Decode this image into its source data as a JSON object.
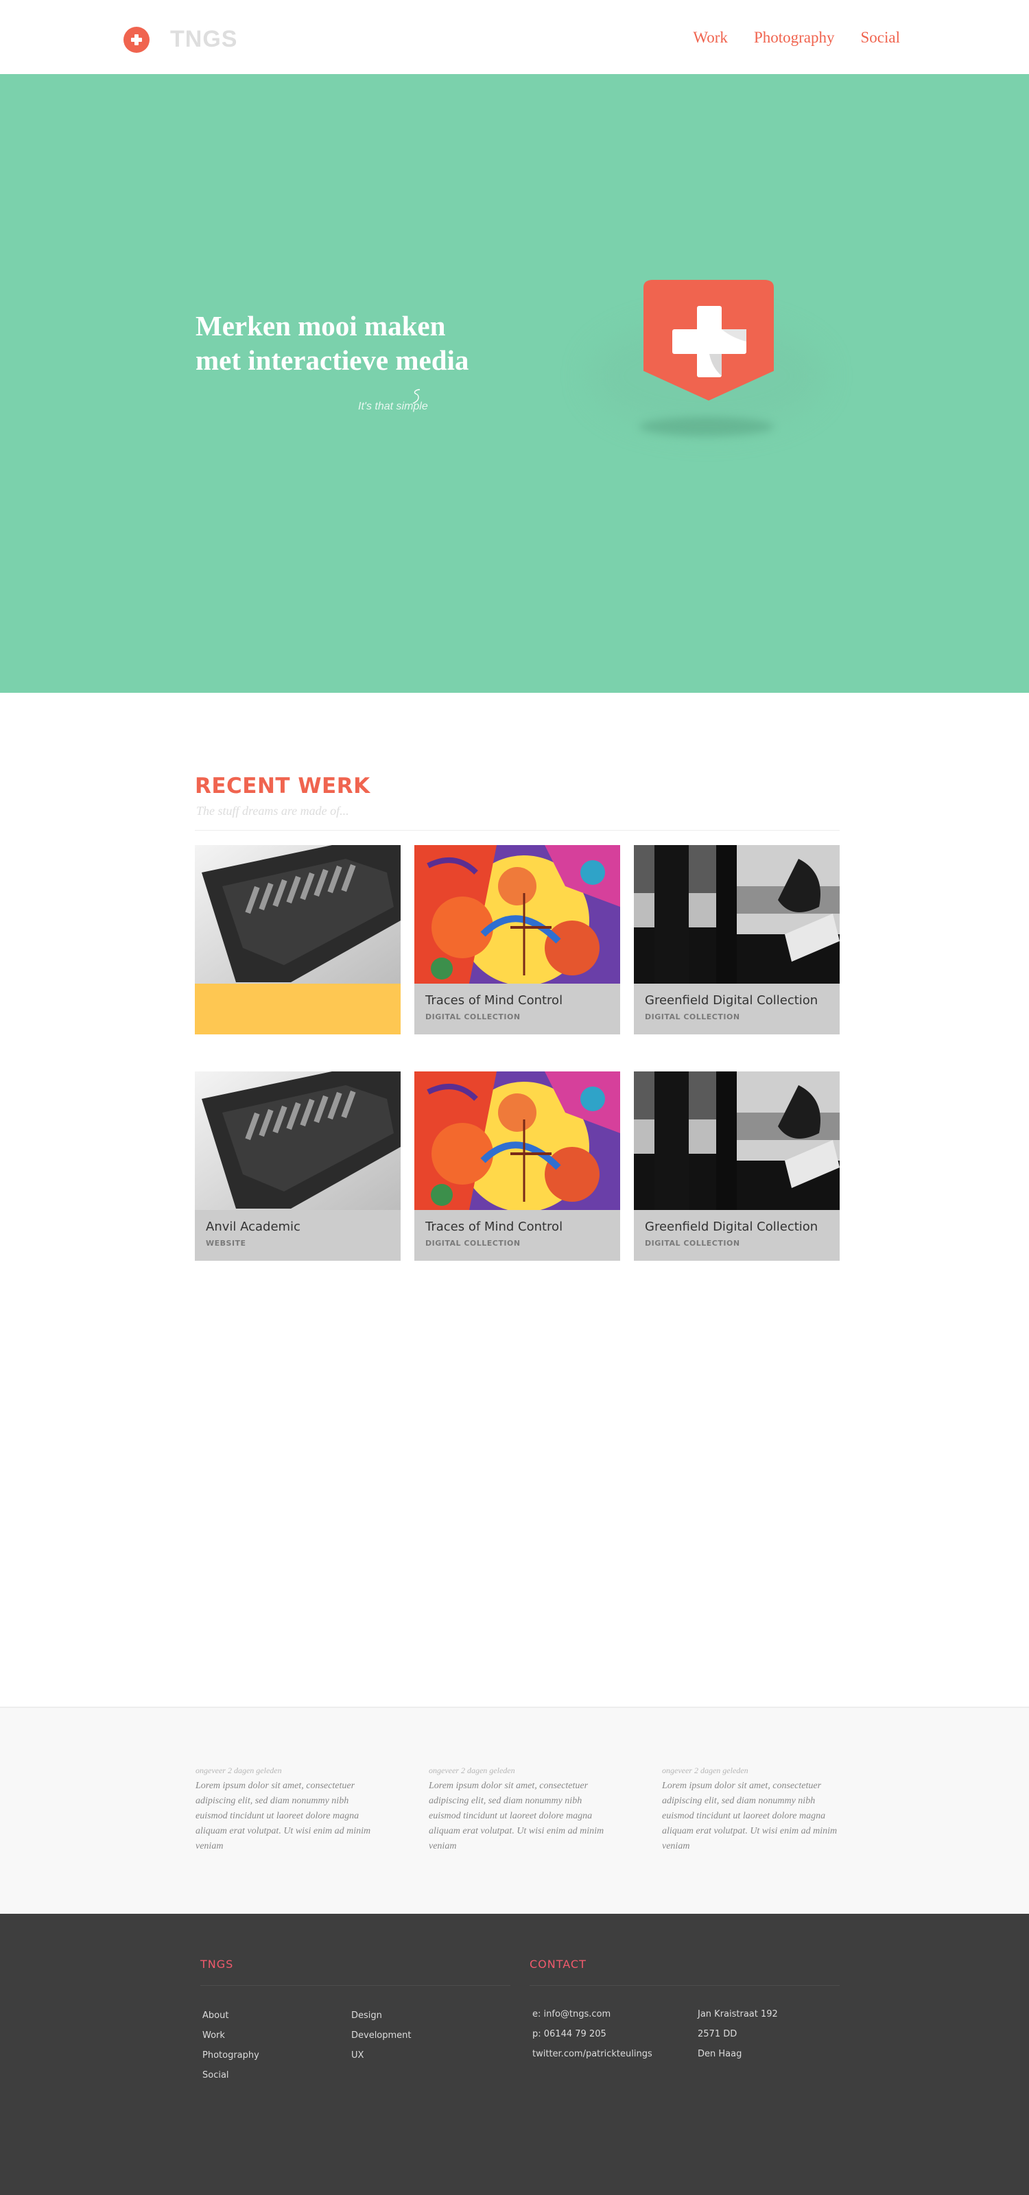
{
  "header": {
    "logo_text": "TNGS",
    "nav": [
      {
        "label": "Work"
      },
      {
        "label": "Photography"
      },
      {
        "label": "Social"
      }
    ]
  },
  "hero": {
    "title_line1": "Merken mooi maken",
    "title_line2": "met interactieve media",
    "subtitle": "It's that simple"
  },
  "recent_work": {
    "title": "RECENT WERK",
    "subtitle": "The stuff dreams are made of...",
    "cards": [
      {
        "title": "",
        "category": "",
        "image": "kindle-photo",
        "highlight": true
      },
      {
        "title": "Traces of Mind Control",
        "category": "DIGITAL COLLECTION",
        "image": "psychedelic-illustration"
      },
      {
        "title": "Greenfield Digital Collection",
        "category": "DIGITAL COLLECTION",
        "image": "window-photo"
      },
      {
        "title": "Anvil Academic",
        "category": "WEBSITE",
        "image": "kindle-photo"
      },
      {
        "title": "Traces of Mind Control",
        "category": "DIGITAL COLLECTION",
        "image": "psychedelic-illustration"
      },
      {
        "title": "Greenfield Digital Collection",
        "category": "DIGITAL COLLECTION",
        "image": "window-photo"
      }
    ]
  },
  "blog": [
    {
      "meta": "ongeveer 2 dagen geleden",
      "text": "Lorem ipsum dolor sit amet, consectetuer adipiscing elit, sed diam nonummy nibh euismod tincidunt ut laoreet dolore magna aliquam erat volutpat. Ut wisi enim ad minim veniam"
    },
    {
      "meta": "ongeveer 2 dagen geleden",
      "text": "Lorem ipsum dolor sit amet, consectetuer adipiscing elit, sed diam nonummy nibh euismod tincidunt ut laoreet dolore magna aliquam erat volutpat. Ut wisi enim ad minim veniam"
    },
    {
      "meta": "ongeveer 2 dagen geleden",
      "text": "Lorem ipsum dolor sit amet, consectetuer adipiscing elit, sed diam nonummy nibh euismod tincidunt ut laoreet dolore magna aliquam erat volutpat. Ut wisi enim ad minim veniam"
    }
  ],
  "footer": {
    "tngs_heading": "TNGS",
    "contact_heading": "CONTACT",
    "links_col1": [
      "About",
      "Work",
      "Photography",
      "Social"
    ],
    "links_col2": [
      "Design",
      "Development",
      "UX"
    ],
    "contact_lines": [
      "e: info@tngs.com",
      "p: 06144 79 205",
      "twitter.com/patrickteulings"
    ],
    "address_lines": [
      "Jan Kraistraat 192",
      "2571 DD",
      "Den Haag"
    ]
  },
  "colors": {
    "accent": "#f0644f",
    "hero_bg": "#7bd1ac",
    "highlight": "#fec752",
    "footer_bg": "#3e3e3e",
    "footer_heading": "#f05a6c"
  }
}
